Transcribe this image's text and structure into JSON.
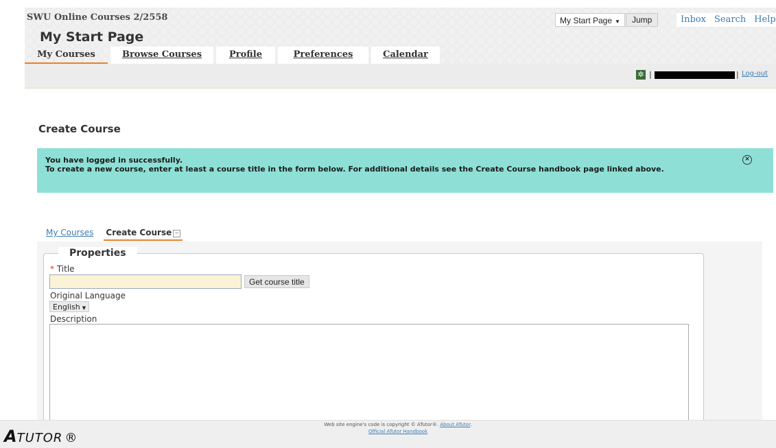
{
  "header": {
    "site_title": "SWU Online Courses 2/2558",
    "jump_select_value": "My Start Page",
    "jump_button": "Jump",
    "top_links": [
      "Inbox",
      "Search",
      "Help"
    ],
    "page_heading": "My Start Page",
    "nav_tabs": [
      "My Courses",
      "Browse Courses",
      "Profile",
      "Preferences",
      "Calendar"
    ],
    "active_tab": "My Courses",
    "logout": "Log-out",
    "separator": "|"
  },
  "main": {
    "heading": "Create Course",
    "feedback": {
      "line1": "You have logged in successfully.",
      "line2": "To create a new course, enter at least a course title in the form below. For additional details see the Create Course handbook page linked above.",
      "close_glyph": "×"
    },
    "subtabs": {
      "link": "My Courses",
      "active": "Create Course",
      "toggle_glyph": "−"
    },
    "form": {
      "legend": "Properties",
      "required_mark": "*",
      "title_label": "Title",
      "title_value": "",
      "get_title_button": "Get course title",
      "language_label": "Original Language",
      "language_value": "English",
      "description_label": "Description",
      "description_value": ""
    }
  },
  "footer": {
    "logo_first": "A",
    "logo_rest": "TUTOR",
    "logo_mark": "®",
    "copyright": "Web site engine's code is copyright © ATutor®.",
    "about_link": "About ATutor",
    "handbook_link": "Official ATutor Handbook"
  },
  "icons": {
    "gear": "gear-icon",
    "caret": "chevron-down-icon",
    "close": "close-icon",
    "toggle": "collapse-icon"
  },
  "colors": {
    "feedback_bg": "#8ee0d6",
    "active_tab_underline": "#e8802c",
    "link": "#3b7bb1",
    "title_input_bg": "#fbf3d5"
  }
}
